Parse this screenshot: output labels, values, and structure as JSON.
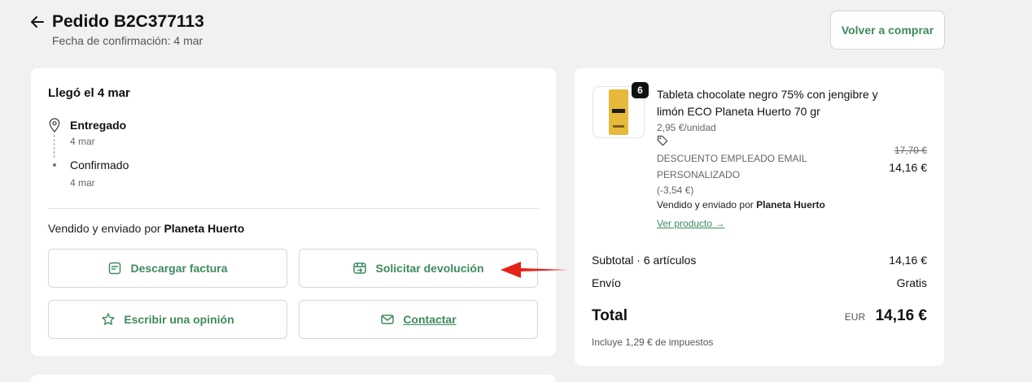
{
  "header": {
    "title": "Pedido B2C377113",
    "subtitle": "Fecha de confirmación: 4 mar",
    "rebuy_label": "Volver a comprar"
  },
  "status_card": {
    "heading": "Llegó el 4 mar",
    "timeline": [
      {
        "status": "Entregado",
        "date": "4 mar"
      },
      {
        "status": "Confirmado",
        "date": "4 mar"
      }
    ],
    "sold_by_prefix": "Vendido y enviado por",
    "seller": "Planeta Huerto",
    "actions": {
      "invoice": "Descargar factura",
      "return": "Solicitar devolución",
      "review": "Escribir una opinión",
      "contact": "Contactar"
    }
  },
  "product": {
    "quantity": "6",
    "name": "Tableta chocolate negro 75% con jengibre y limón ECO Planeta Huerto 70 gr",
    "unit_price": "2,95 €/unidad",
    "discount_label": "DESCUENTO EMPLEADO EMAIL PERSONALIZADO",
    "discount_amount": "(-3,54 €)",
    "seller_prefix": "Vendido y enviado por",
    "seller": "Planeta Huerto",
    "view_link": "Ver producto →",
    "old_price": "17,70 €",
    "new_price": "14,16 €"
  },
  "summary": {
    "subtotal_label": "Subtotal · 6 artículos",
    "subtotal_value": "14,16 €",
    "shipping_label": "Envío",
    "shipping_value": "Gratis",
    "total_label": "Total",
    "currency": "EUR",
    "total_value": "14,16 €",
    "tax_note": "Incluye 1,29 € de impuestos"
  },
  "icons": {
    "back": "arrow-left-icon",
    "pin": "location-pin-icon",
    "invoice": "document-icon",
    "return": "return-box-icon",
    "review": "star-icon",
    "contact": "mail-icon",
    "tag": "tag-icon"
  },
  "colors": {
    "accent": "#3e8a5c",
    "annotation_arrow": "#e8201a"
  }
}
